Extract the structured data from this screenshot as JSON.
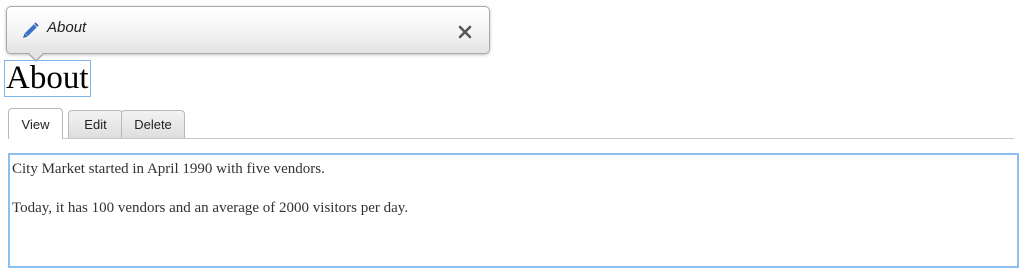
{
  "tooltip": {
    "title": "About",
    "icons": {
      "edit": "pencil-icon",
      "close": "close-icon"
    },
    "accent_color": "#3a72c8"
  },
  "page": {
    "title": "About"
  },
  "tabs": [
    {
      "label": "View",
      "active": true
    },
    {
      "label": "Edit",
      "active": false
    },
    {
      "label": "Delete",
      "active": false
    }
  ],
  "content": {
    "paragraphs": [
      "City Market started in April 1990 with five vendors.",
      "Today, it has 100 vendors and an average of 2000 visitors per day."
    ]
  },
  "colors": {
    "focus_border": "#8cbfee",
    "title_border": "#7fb5ea"
  }
}
